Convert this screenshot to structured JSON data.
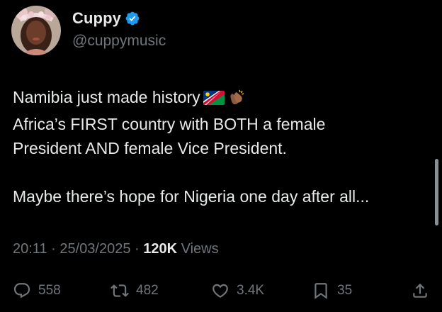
{
  "author": {
    "display_name": "Cuppy",
    "handle": "@cuppymusic",
    "verified": true
  },
  "tweet": {
    "lines": [
      "Namibia just made history",
      "Africa’s FIRST country with BOTH a female",
      "President AND female Vice President.",
      "Maybe there’s hope for Nigeria one day after all..."
    ],
    "emoji": [
      "namibia-flag-emoji",
      "clapping-hands-emoji"
    ]
  },
  "meta": {
    "time": "20:11",
    "separator": " · ",
    "date": "25/03/2025",
    "views_count": "120K",
    "views_label": "Views"
  },
  "actions": {
    "replies": "558",
    "reposts": "482",
    "likes": "3.4K",
    "bookmarks": "35"
  },
  "colors": {
    "background": "#000000",
    "primary_text": "#e7e9ea",
    "secondary_text": "#71767b",
    "verified_badge": "#1d9bf0"
  }
}
